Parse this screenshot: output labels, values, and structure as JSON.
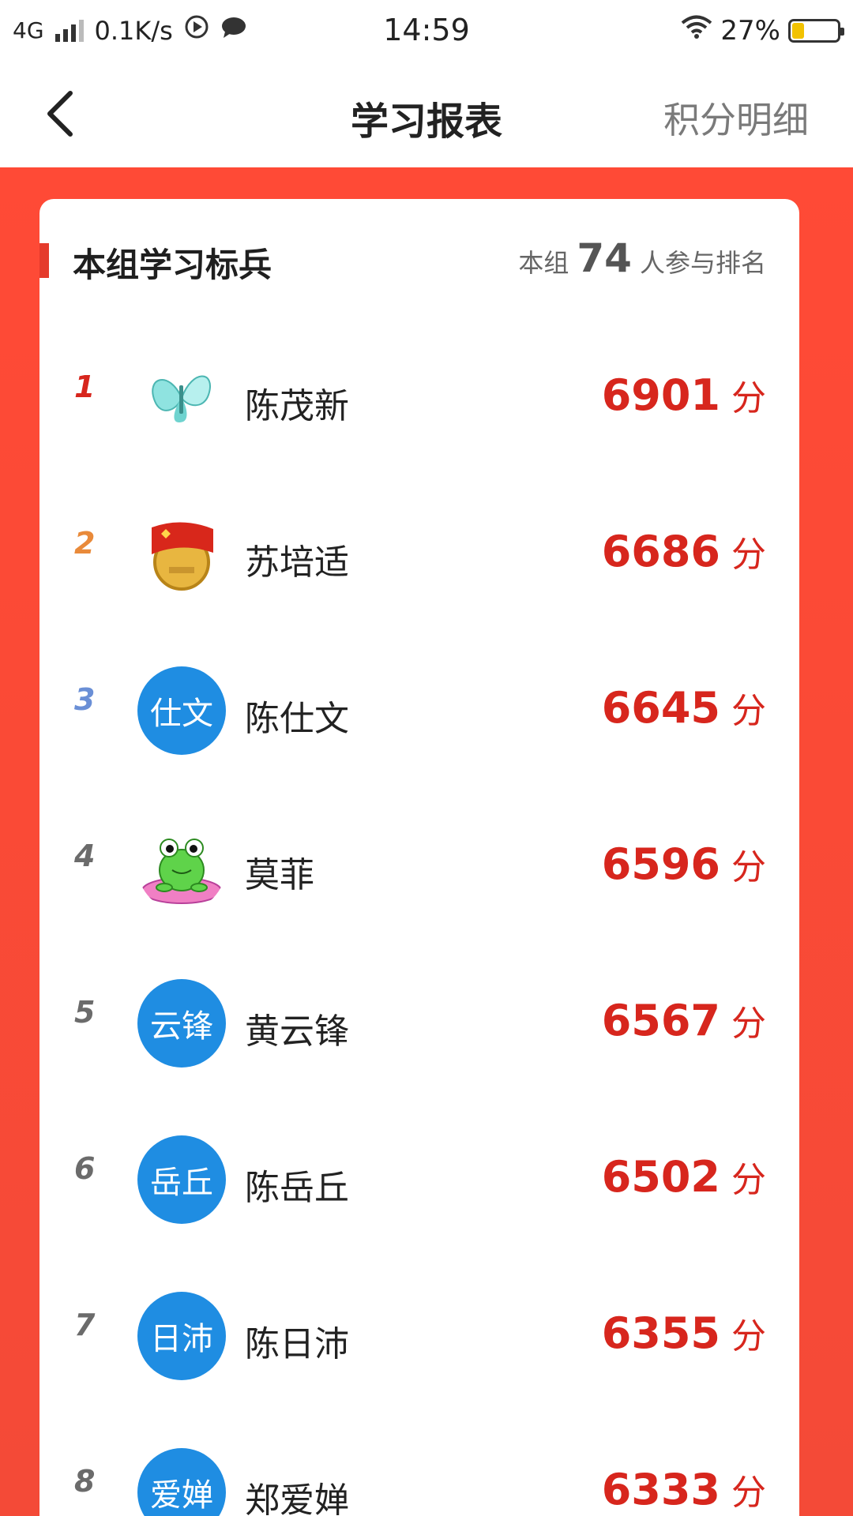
{
  "status_bar": {
    "network": "4G",
    "speed": "0.1K/s",
    "time": "14:59",
    "battery": "27%",
    "battery_level": 0.27
  },
  "header": {
    "title": "学习报表",
    "action": "积分明细"
  },
  "card": {
    "title": "本组学习标兵",
    "participants_prefix": "本组",
    "participants_count": "74",
    "participants_suffix": "人参与排名"
  },
  "rankings": [
    {
      "rank": "1",
      "name": "陈茂新",
      "score": "6901",
      "unit": "分",
      "avatar_type": "butterfly-icon",
      "avatar_text": ""
    },
    {
      "rank": "2",
      "name": "苏培适",
      "score": "6686",
      "unit": "分",
      "avatar_type": "flag-badge-icon",
      "avatar_text": ""
    },
    {
      "rank": "3",
      "name": "陈仕文",
      "score": "6645",
      "unit": "分",
      "avatar_type": "text",
      "avatar_text": "仕文"
    },
    {
      "rank": "4",
      "name": "莫菲",
      "score": "6596",
      "unit": "分",
      "avatar_type": "frog-icon",
      "avatar_text": ""
    },
    {
      "rank": "5",
      "name": "黄云锋",
      "score": "6567",
      "unit": "分",
      "avatar_type": "text",
      "avatar_text": "云锋"
    },
    {
      "rank": "6",
      "name": "陈岳丘",
      "score": "6502",
      "unit": "分",
      "avatar_type": "text",
      "avatar_text": "岳丘"
    },
    {
      "rank": "7",
      "name": "陈日沛",
      "score": "6355",
      "unit": "分",
      "avatar_type": "text",
      "avatar_text": "日沛"
    },
    {
      "rank": "8",
      "name": "郑爱婵",
      "score": "6333",
      "unit": "分",
      "avatar_type": "text",
      "avatar_text": "爱婵"
    }
  ],
  "colors": {
    "accent_red": "#d7261d",
    "background_red": "#f44a37",
    "avatar_blue": "#1f8de2",
    "rank1": "#d7261d",
    "rank2": "#e98a3a",
    "rank3": "#6a8fd6"
  }
}
